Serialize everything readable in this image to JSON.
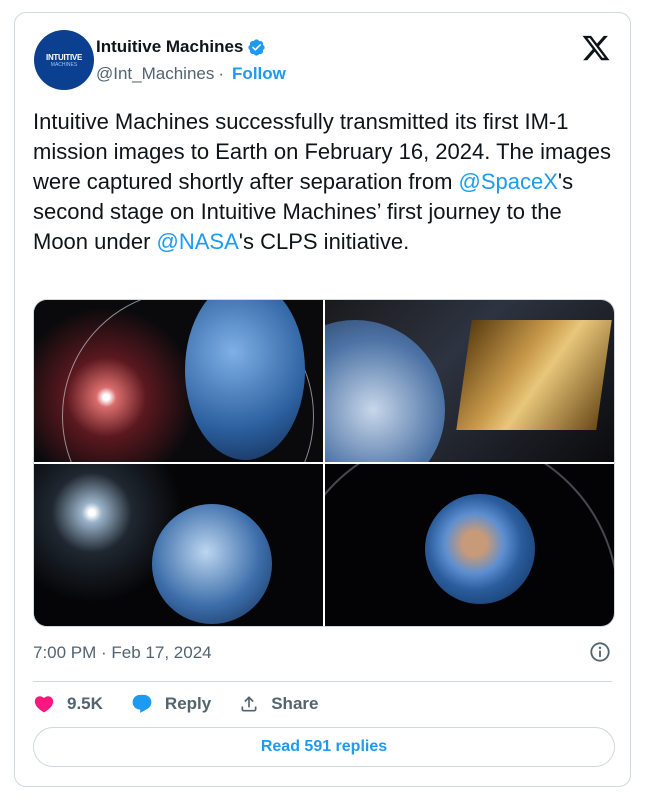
{
  "author": {
    "display_name": "Intuitive Machines",
    "handle": "@Int_Machines",
    "separator": "·",
    "follow_label": "Follow",
    "avatar_text": "INTUITIVE",
    "avatar_sub": "MACHINES"
  },
  "tweet": {
    "text_1": "Intuitive Machines successfully transmitted its first IM-1 mission images to Earth on February 16, 2024. The images were captured shortly after separation from ",
    "mention_1": "@SpaceX",
    "text_2": "'s second stage on Intuitive Machines’ first journey to the Moon under ",
    "mention_2": "@NASA",
    "text_3": "'s  CLPS initiative.",
    "timestamp": "7:00 PM · Feb 17, 2024"
  },
  "actions": {
    "likes": "9.5K",
    "reply_label": "Reply",
    "share_label": "Share"
  },
  "read_replies_label": "Read 591 replies",
  "icons": {
    "verified": "verified-badge-icon",
    "brand": "x-logo-icon",
    "like": "heart-icon",
    "reply": "reply-bubble-icon",
    "share": "share-icon",
    "info": "info-icon"
  },
  "colors": {
    "accent": "#1d9bf0",
    "like": "#f91880",
    "muted": "#536471"
  }
}
